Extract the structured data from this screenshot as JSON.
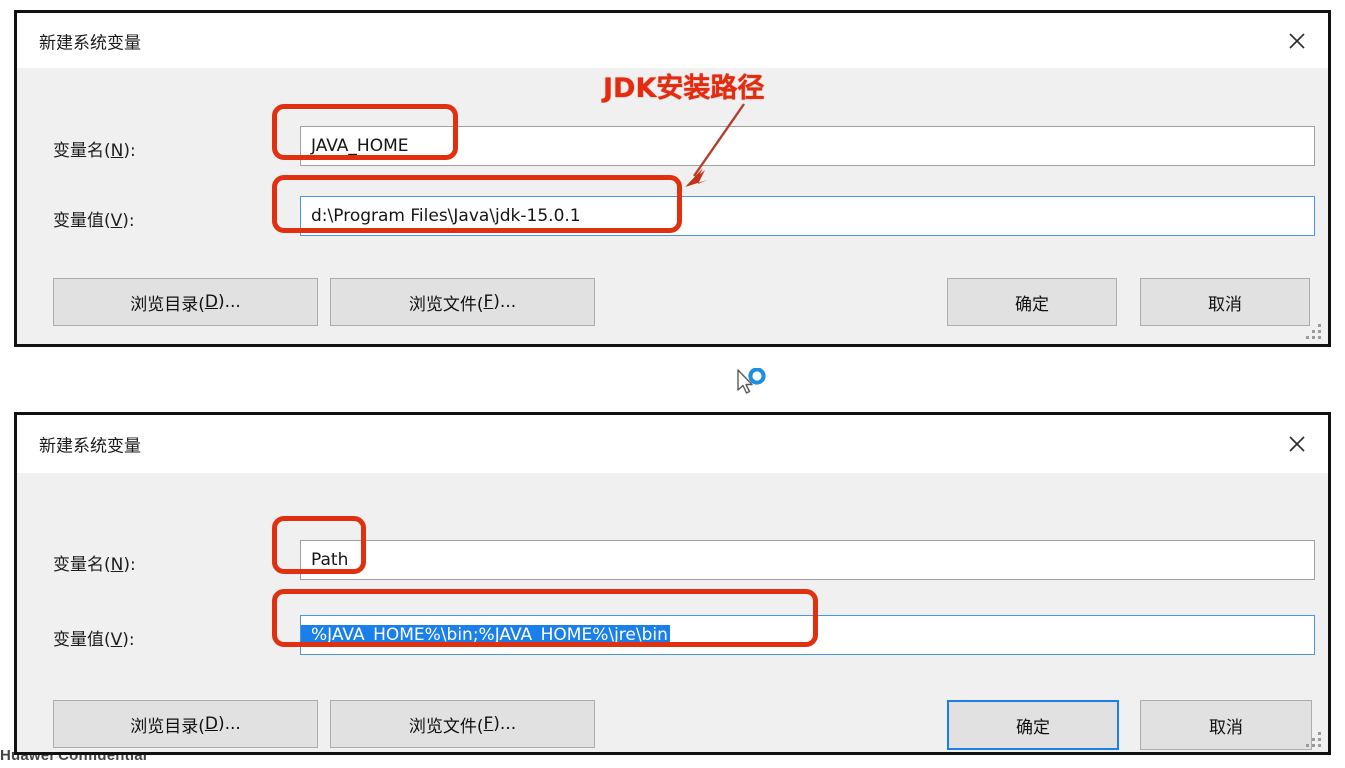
{
  "dialogs": [
    {
      "title": "新建系统变量",
      "close_icon": "close-icon",
      "name_label_prefix": "变量名(",
      "name_label_key": "N",
      "name_label_suffix": "):",
      "value_label_prefix": "变量值(",
      "value_label_key": "V",
      "value_label_suffix": "):",
      "name_value": "JAVA_HOME",
      "value_value": "d:\\Program Files\\Java\\jdk-15.0.1",
      "browse_dir_prefix": "浏览目录(",
      "browse_dir_key": "D",
      "browse_dir_suffix": ")...",
      "browse_file_prefix": "浏览文件(",
      "browse_file_key": "F",
      "browse_file_suffix": ")...",
      "ok_label": "确定",
      "cancel_label": "取消"
    },
    {
      "title": "新建系统变量",
      "close_icon": "close-icon",
      "name_label_prefix": "变量名(",
      "name_label_key": "N",
      "name_label_suffix": "):",
      "value_label_prefix": "变量值(",
      "value_label_key": "V",
      "value_label_suffix": "):",
      "name_value": "Path",
      "value_value": "%JAVA_HOME%\\bin;%JAVA_HOME%\\jre\\bin",
      "browse_dir_prefix": "浏览目录(",
      "browse_dir_key": "D",
      "browse_dir_suffix": ")...",
      "browse_file_prefix": "浏览文件(",
      "browse_file_key": "F",
      "browse_file_suffix": ")...",
      "ok_label": "确定",
      "cancel_label": "取消"
    }
  ],
  "annotation": {
    "callout_text": "JDK安装路径",
    "color": "#e32b10",
    "arrow_color": "#b2402f"
  },
  "cursor": {
    "icon": "cursor-busy-icon"
  },
  "watermark": {
    "text": "Huawei Confidential"
  },
  "colors": {
    "dialog_bg": "#f0f0f0",
    "titlebar_bg": "#ffffff",
    "border": "#111111",
    "button_bg": "#e1e1e1",
    "focus_blue": "#1a7fe8",
    "selection_blue": "#1a7fe8",
    "annotation_red": "#e03010"
  }
}
